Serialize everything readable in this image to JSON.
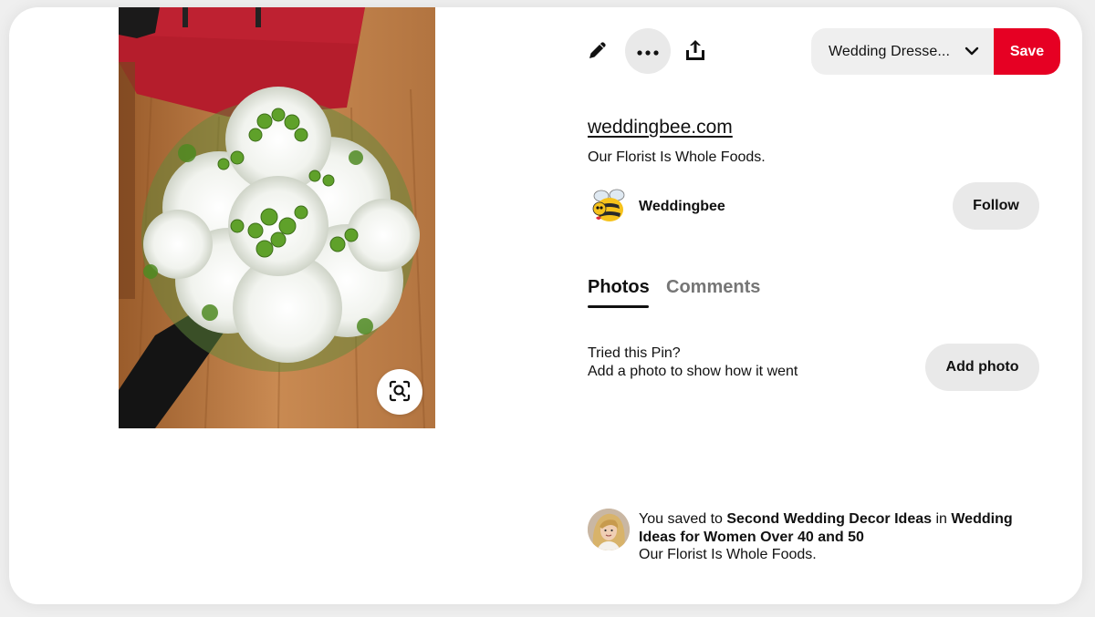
{
  "toolbar": {
    "edit_icon": "pencil-icon",
    "more_icon": "ellipsis-icon",
    "share_icon": "share-upload-icon",
    "board_select": "Wedding Dresse...",
    "save_label": "Save",
    "accent_color": "#e60023"
  },
  "pin": {
    "source_link": "weddingbee.com",
    "title": "Our Florist Is Whole Foods.",
    "lens_icon": "visual-search-icon"
  },
  "creator": {
    "name": "Weddingbee",
    "follow_label": "Follow"
  },
  "tabs": {
    "photos": "Photos",
    "comments": "Comments",
    "active": "Photos"
  },
  "tried": {
    "title": "Tried this Pin?",
    "subtitle": "Add a photo to show how it went",
    "add_photo_label": "Add photo"
  },
  "saved": {
    "prefix": "You saved to ",
    "board": "Second Wedding Decor Ideas",
    "middle": " in ",
    "section": "Wedding Ideas for Women Over 40 and 50",
    "description": "Our Florist Is Whole Foods."
  }
}
